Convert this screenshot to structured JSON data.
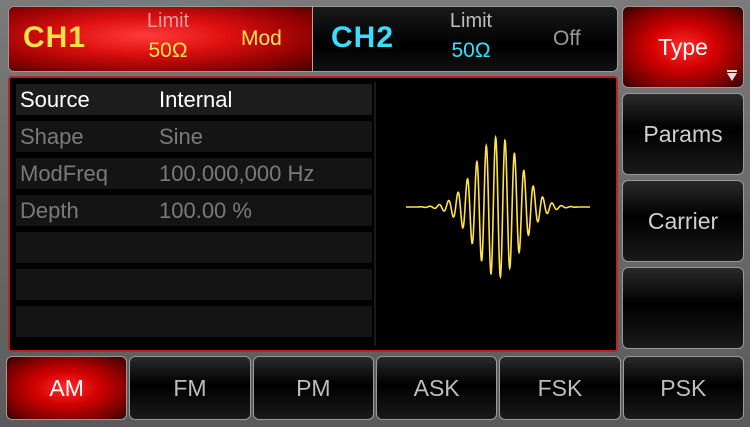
{
  "header": {
    "ch1": {
      "name": "CH1",
      "limit_label": "Limit",
      "impedance": "50Ω",
      "mode": "Mod"
    },
    "ch2": {
      "name": "CH2",
      "limit_label": "Limit",
      "impedance": "50Ω",
      "mode": "Off"
    }
  },
  "params": {
    "rows": [
      {
        "key": "Source",
        "value": "Internal"
      },
      {
        "key": "Shape",
        "value": "Sine"
      },
      {
        "key": "ModFreq",
        "value": "100.000,000 Hz"
      },
      {
        "key": "Depth",
        "value": "100.00 %"
      },
      {
        "key": "",
        "value": ""
      },
      {
        "key": "",
        "value": ""
      },
      {
        "key": "",
        "value": ""
      }
    ]
  },
  "softkeys": {
    "type": "Type",
    "params": "Params",
    "carrier": "Carrier",
    "empty": ""
  },
  "tabs": [
    "AM",
    "FM",
    "PM",
    "ASK",
    "FSK",
    "PSK"
  ],
  "colors": {
    "ch1_text": "#ffe14a",
    "ch2_text": "#35e0ff",
    "accent_red": "#e01010",
    "waveform": "#ffe14a"
  },
  "icons": {
    "dropdown": "triangle-down-icon"
  }
}
